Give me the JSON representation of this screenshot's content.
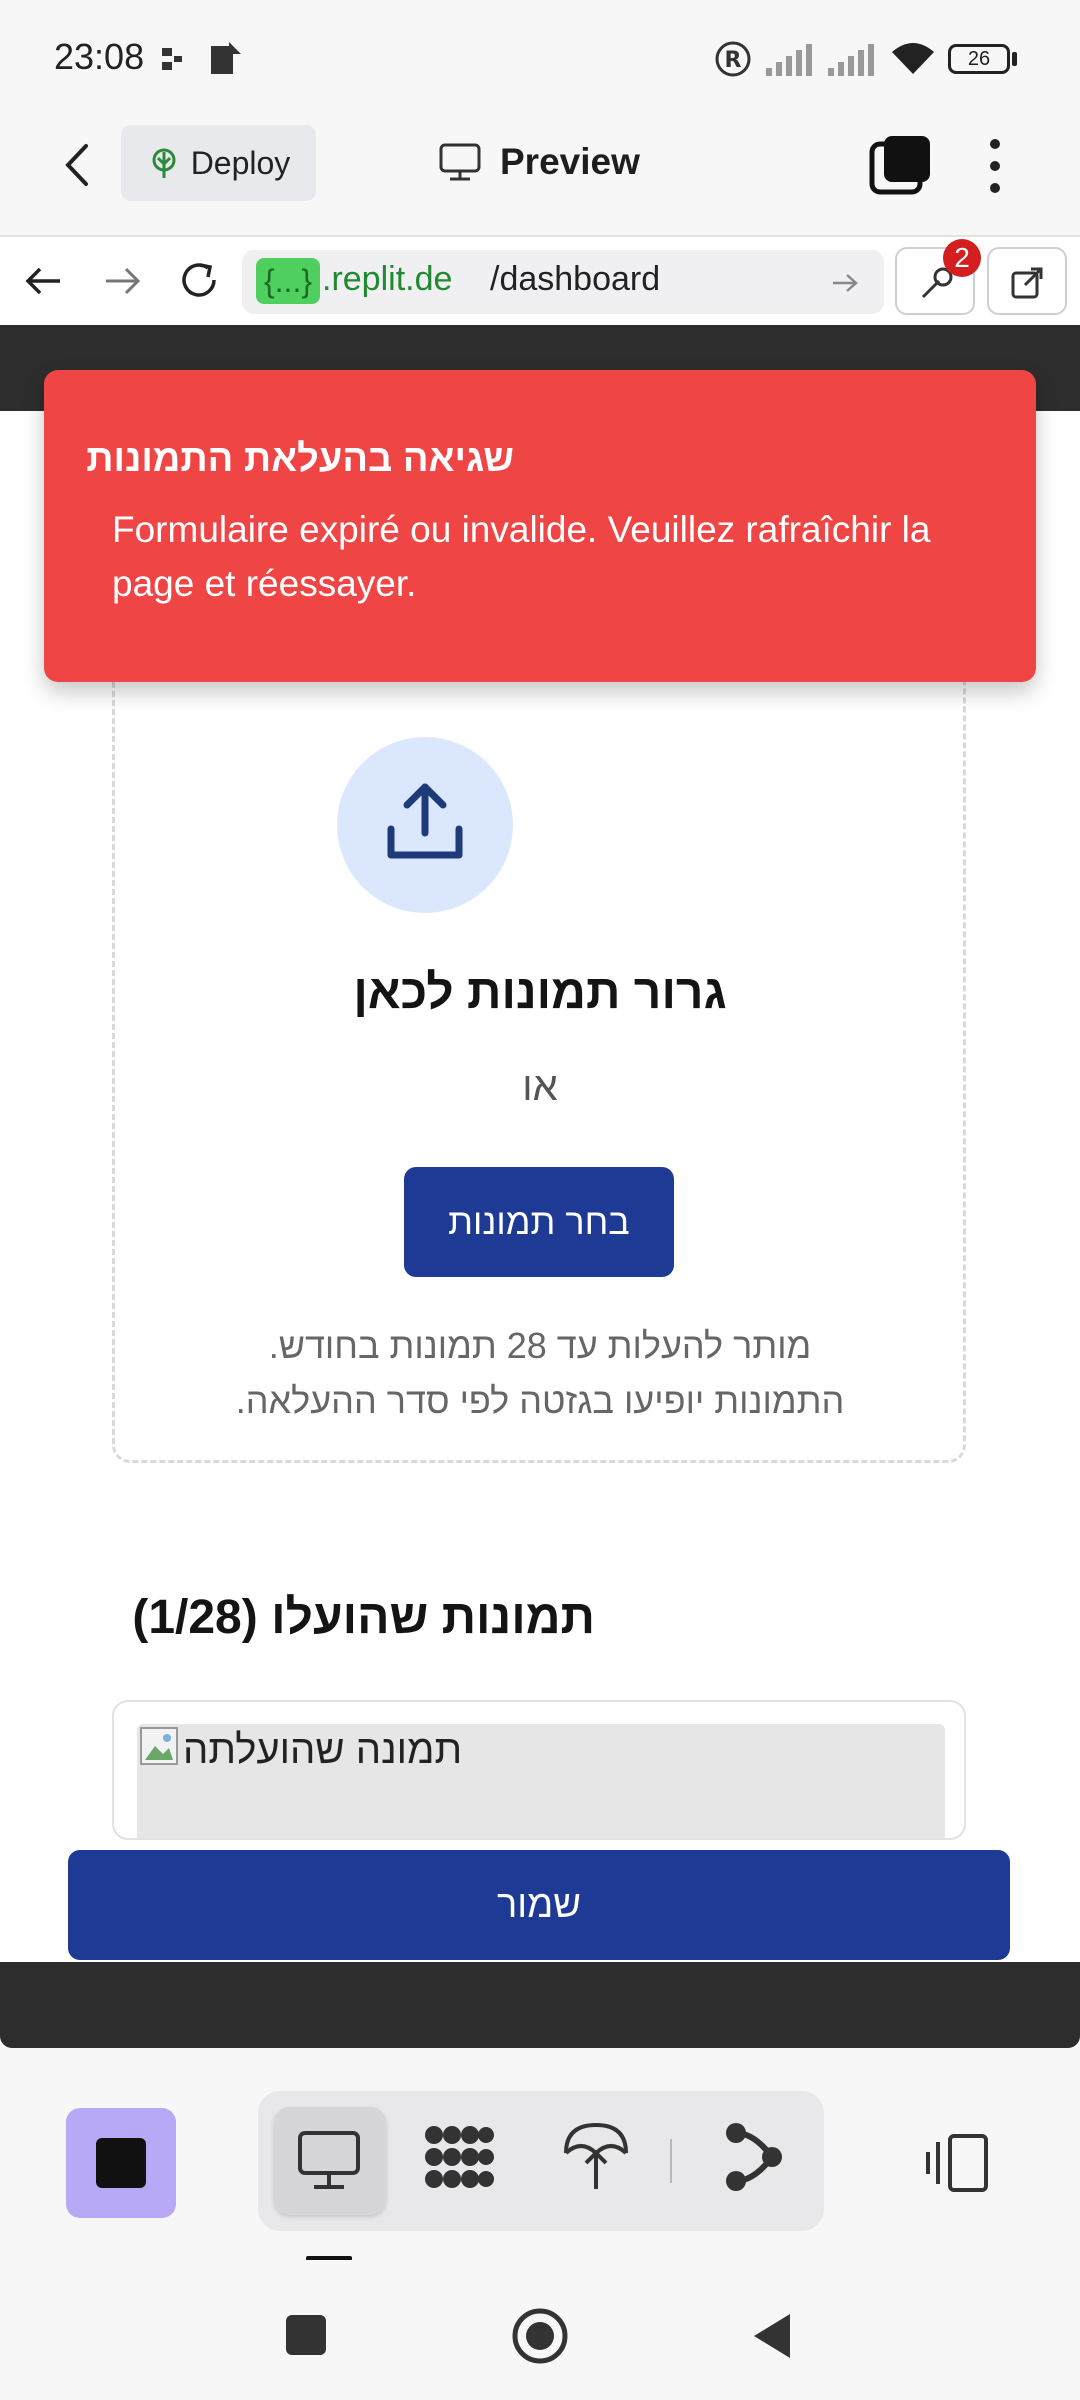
{
  "status_bar": {
    "time": "23:08",
    "battery": "26"
  },
  "app_bar": {
    "deploy_label": "Deploy",
    "preview_label": "Preview"
  },
  "url_bar": {
    "host_badge": "{...}",
    "host": ".replit.de",
    "path": "/dashboard",
    "devtools_badge": "2"
  },
  "toast": {
    "title": "שגיאה בהעלאת התמונות",
    "message": "Formulaire expiré ou invalide. Veuillez rafraîchir la page et réessayer."
  },
  "upload": {
    "drag_title": "גרור תמונות לכאן",
    "or": "או",
    "choose_button": "בחר תמונות",
    "hint_line1": "מותר להעלות עד 28 תמונות בחודש.",
    "hint_line2": "התמונות יופיעו בגזטה לפי סדר ההעלאה."
  },
  "uploaded": {
    "title": "תמונות שהועלו (1/28)",
    "image_alt": "תמונה שהועלתה"
  },
  "save_button": "שמור",
  "colors": {
    "primary": "#1e3a94",
    "error": "#ef4545",
    "upload_circle": "#dbe7fd",
    "stop_button": "#b9a8f5"
  }
}
